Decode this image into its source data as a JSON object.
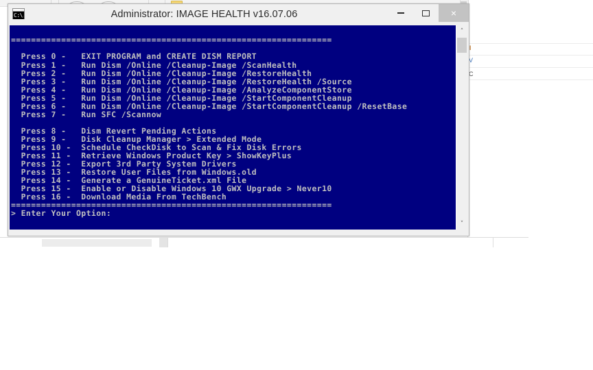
{
  "window": {
    "title": "Administrator:  IMAGE HEALTH v16.07.06",
    "icon_label": "C:\\.",
    "icon_dots": "···",
    "buttons": {
      "minimize": "—",
      "maximize": "□",
      "close": "×"
    }
  },
  "scrollbar": {
    "up_arrow": "˄",
    "down_arrow": "˅"
  },
  "console": {
    "separator_top": "================================================================",
    "separator_bottom": "================================================================",
    "blank": "",
    "prompt": "> Enter Your Option:",
    "colors": {
      "background": "#000080",
      "foreground": "#c0c0c0"
    },
    "menu": [
      "  Press 0 -   EXIT PROGRAM and CREATE DISM REPORT",
      "  Press 1 -   Run Dism /Online /Cleanup-Image /ScanHealth",
      "  Press 2 -   Run Dism /Online /Cleanup-Image /RestoreHealth",
      "  Press 3 -   Run Dism /Online /Cleanup-Image /RestoreHealth /Source",
      "  Press 4 -   Run Dism /Online /Cleanup-Image /AnalyzeComponentStore",
      "  Press 5 -   Run Dism /Online /Cleanup-Image /StartComponentCleanup",
      "  Press 6 -   Run Dism /Online /Cleanup-Image /StartComponentCleanup /ResetBase",
      "  Press 7 -   Run SFC /Scannow",
      "",
      "  Press 8 -   Dism Revert Pending Actions",
      "  Press 9 -   Disk Cleanup Manager > Extended Mode",
      "  Press 10 -  Schedule CheckDisk to Scan & Fix Disk Errors",
      "  Press 11 -  Retrieve Windows Product Key > ShowKeyPlus",
      "  Press 12 -  Export 3rd Party System Drivers",
      "  Press 13 -  Restore User Files from Windows.old",
      "  Press 14 -  Generate a GenuineTicket.xml File",
      "  Press 15 -  Enable or Disable Windows 10 GWX Upgrade > Never10",
      "  Press 16 -  Download Media From TechBench"
    ]
  },
  "background": {
    "list_glyphs": [
      "‖",
      "V",
      "C"
    ]
  }
}
